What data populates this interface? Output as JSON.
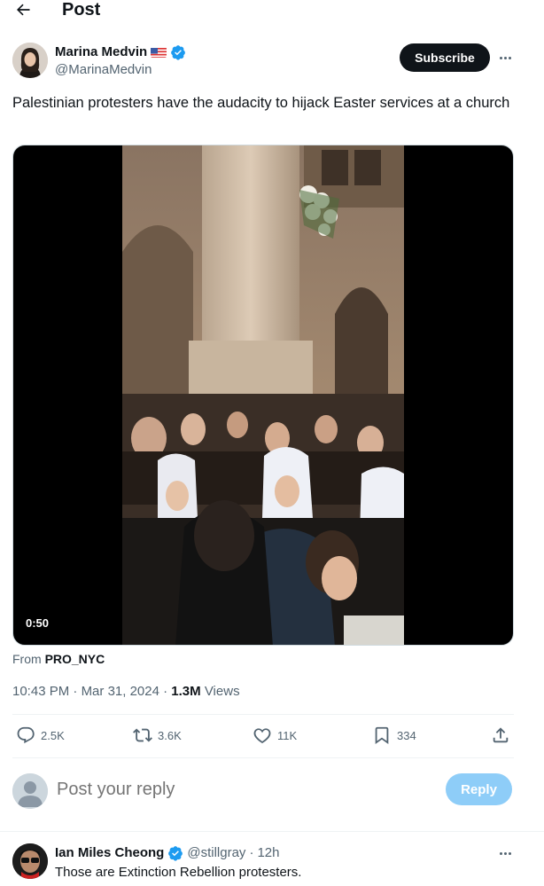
{
  "header": {
    "title": "Post"
  },
  "post": {
    "author_name": "Marina Medvin",
    "author_handle": "@MarinaMedvin",
    "subscribe_label": "Subscribe",
    "text": "Palestinian protesters have the audacity to hijack Easter services at a church",
    "video_duration": "0:50",
    "from_label": "From",
    "from_source": "PRO_NYC",
    "time": "10:43 PM",
    "date": "Mar 31, 2024",
    "views_count": "1.3M",
    "views_label": "Views",
    "sep": " · "
  },
  "actions": {
    "replies": "2.5K",
    "reposts": "3.6K",
    "likes": "11K",
    "bookmarks": "334"
  },
  "reply_box": {
    "placeholder": "Post your reply",
    "button": "Reply"
  },
  "comment": {
    "name": "Ian Miles Cheong",
    "handle": "@stillgray",
    "time": "12h",
    "text": "Those are Extinction Rebellion protesters."
  },
  "icons": {
    "back": "arrow-left-icon",
    "verified": "verified-badge-icon",
    "flag": "us-flag-icon",
    "reply": "reply-icon",
    "repost": "repost-icon",
    "like": "heart-icon",
    "bookmark": "bookmark-icon",
    "share": "share-icon",
    "more": "more-icon"
  },
  "colors": {
    "verified": "#1d9bf0",
    "reply_button": "#8ecdf8",
    "subscribe_bg": "#0f1419",
    "muted": "#536471"
  }
}
